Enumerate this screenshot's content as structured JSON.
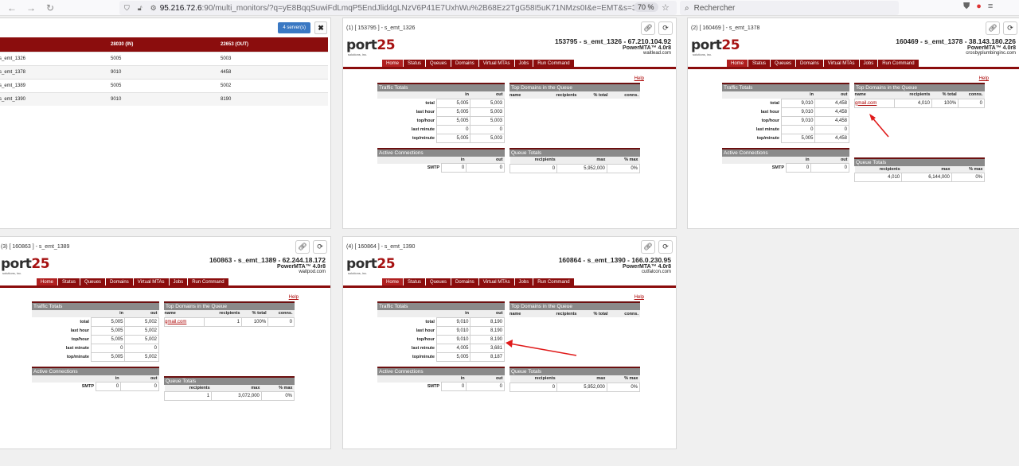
{
  "browser": {
    "url_host": "95.216.72.6",
    "url_rest": ":90/multi_monitors/?q=yE8BqqSuwiFdLmqP5EndJlid4gLNzV6P41E7UxhWu%2B68Ez2TgG58I5uK71NMzs0I&e=EMT&s=3",
    "zoom": "70 %",
    "search_placeholder": "Rechercher"
  },
  "summary": {
    "servers_button": "4 server(s)",
    "close": "✖",
    "columns": [
      "",
      "28030 (IN)",
      "22653 (OUT)"
    ],
    "rows": [
      [
        "s_emt_1326",
        "5005",
        "5003"
      ],
      [
        "s_emt_1378",
        "9010",
        "4458"
      ],
      [
        "s_emt_1389",
        "5005",
        "5002"
      ],
      [
        "s_emt_1390",
        "9010",
        "8190"
      ]
    ]
  },
  "common": {
    "logo_num": "port",
    "logo_suffix": "25",
    "logo_sub": "solutions, inc.",
    "version": "PowerMTA™ 4.0r8",
    "tabs": [
      "Home",
      "Status",
      "Queues",
      "Domains",
      "Virtual MTAs",
      "Jobs",
      "Run Command"
    ],
    "help": "Help",
    "traffic_title": "Traffic Totals",
    "domains_title": "Top Domains in the Queue",
    "active_title": "Active Connections",
    "queue_title": "Queue Totals",
    "col_in": "in",
    "col_out": "out",
    "dom_cols": [
      "name",
      "recipients",
      "% total",
      "conns."
    ],
    "queue_cols": [
      "recipients",
      "max",
      "% max"
    ],
    "traffic_labels": [
      "total",
      "last hour",
      "top/hour",
      "last minute",
      "top/minute"
    ],
    "smtp_label": "SMTP"
  },
  "monitors": [
    {
      "header": "(1) [ 153795 ] - s_emt_1326",
      "title": "153795 - s_emt_1326 - 67.210.104.92",
      "host": "waitlead.com",
      "traffic": [
        [
          "5,005",
          "5,003"
        ],
        [
          "5,005",
          "5,003"
        ],
        [
          "5,005",
          "5,003"
        ],
        [
          "0",
          "0"
        ],
        [
          "5,005",
          "5,003"
        ]
      ],
      "domain": null,
      "smtp": [
        "0",
        "0"
      ],
      "queue": [
        "0",
        "5,952,000",
        "0%"
      ]
    },
    {
      "header": "(2) [ 160469 ] - s_emt_1378",
      "title": "160469 - s_emt_1378 - 38.143.180.226",
      "host": "crosbyplumbinginc.com",
      "traffic": [
        [
          "9,010",
          "4,458"
        ],
        [
          "9,010",
          "4,458"
        ],
        [
          "9,010",
          "4,458"
        ],
        [
          "0",
          "0"
        ],
        [
          "5,005",
          "4,458"
        ]
      ],
      "domain": [
        "gmail.com",
        "4,010",
        "100%",
        "0"
      ],
      "smtp": [
        "0",
        "0"
      ],
      "queue": [
        "4,010",
        "6,144,000",
        "0%"
      ]
    },
    {
      "header": "(3) [ 160863 ] - s_emt_1389",
      "title": "160863 - s_emt_1389 - 62.244.18.172",
      "host": "waitpod.com",
      "traffic": [
        [
          "5,005",
          "5,002"
        ],
        [
          "5,005",
          "5,002"
        ],
        [
          "5,005",
          "5,002"
        ],
        [
          "0",
          "0"
        ],
        [
          "5,005",
          "5,002"
        ]
      ],
      "domain": [
        "gmail.com",
        "1",
        "100%",
        "0"
      ],
      "smtp": [
        "0",
        "0"
      ],
      "queue": [
        "1",
        "3,072,000",
        "0%"
      ]
    },
    {
      "header": "(4) [ 160864 ] - s_emt_1390",
      "title": "160864 - s_emt_1390 - 166.0.230.95",
      "host": "cutfalcon.com",
      "traffic": [
        [
          "9,010",
          "8,190"
        ],
        [
          "9,010",
          "8,190"
        ],
        [
          "9,010",
          "8,190"
        ],
        [
          "4,005",
          "3,681"
        ],
        [
          "5,005",
          "8,187"
        ]
      ],
      "domain": null,
      "smtp": [
        "0",
        "0"
      ],
      "queue": [
        "0",
        "5,952,000",
        "0%"
      ]
    }
  ],
  "colors": {
    "brand_red": "#8b0d0d",
    "link_red": "#aa0000",
    "accent_blue": "#3a78c3",
    "annotation_red": "#e01b1b"
  }
}
